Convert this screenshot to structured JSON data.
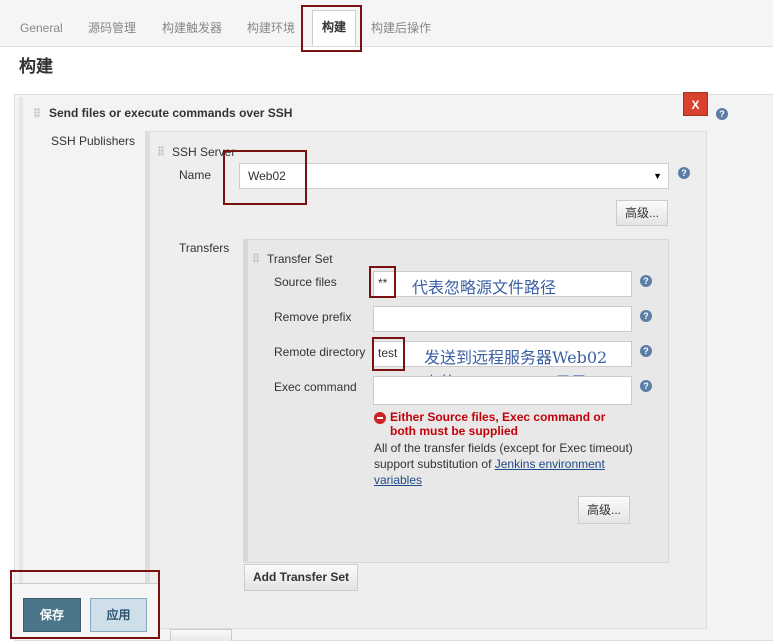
{
  "tabs": [
    {
      "label": "General"
    },
    {
      "label": "源码管理"
    },
    {
      "label": "构建触发器"
    },
    {
      "label": "构建环境"
    },
    {
      "label": "构建"
    },
    {
      "label": "构建后操作"
    }
  ],
  "section_title": "构建",
  "step": {
    "title": "Send files or execute commands over SSH",
    "delete_label": "X",
    "help": "?"
  },
  "publishers_label": "SSH Publishers",
  "server": {
    "title": "SSH Server",
    "name_label": "Name",
    "name_value": "Web02",
    "advanced_label": "高级..."
  },
  "transfers_label": "Transfers",
  "transfer_set": {
    "title": "Transfer Set",
    "source_files_label": "Source files",
    "source_files_value": "**",
    "remove_prefix_label": "Remove prefix",
    "remove_prefix_value": "",
    "remote_directory_label": "Remote directory",
    "remote_directory_value": "test",
    "exec_command_label": "Exec command",
    "exec_command_value": "",
    "error_text": "Either Source files, Exec command or both must be supplied",
    "info_text": "All of the transfer fields (except for Exec timeout) support substitution of ",
    "info_link": "Jenkins environment variables",
    "advanced_label": "高级..."
  },
  "annotations": {
    "source_note": "代表忽略源文件路径",
    "remote_note_line1": "发送到远程服务器Web02",
    "remote_note_line2": "上的/yunwei/test目录"
  },
  "add_transfer_label": "Add Transfer Set",
  "footer": {
    "save_label": "保存",
    "apply_label": "应用"
  },
  "colors": {
    "highlight": "#7a1111",
    "delete_red": "#d9412f",
    "save_blue": "#4b758b",
    "annotation_blue": "#3a5fa3",
    "error_red": "#c4000a"
  }
}
